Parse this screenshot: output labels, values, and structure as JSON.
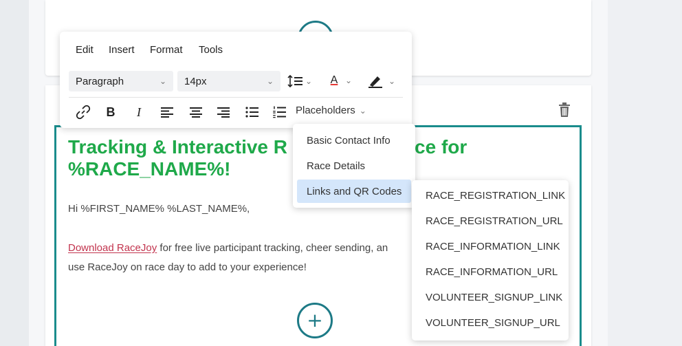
{
  "menubar": {
    "items": [
      {
        "label": "Edit"
      },
      {
        "label": "Insert"
      },
      {
        "label": "Format"
      },
      {
        "label": "Tools"
      }
    ]
  },
  "toolbar": {
    "block_format": "Paragraph",
    "font_size": "14px",
    "text_color": "#e53935",
    "placeholders_label": "Placeholders",
    "icons": [
      "line-height-icon",
      "text-color-icon",
      "highlight-icon",
      "link-icon",
      "bold-icon",
      "italic-icon",
      "align-left-icon",
      "align-center-icon",
      "align-right-icon",
      "bullet-list-icon",
      "numbered-list-icon"
    ],
    "bold_glyph": "B",
    "italic_glyph": "I",
    "text_color_glyph": "A"
  },
  "placeholders_menu": {
    "items": [
      {
        "label": "Basic Contact Info"
      },
      {
        "label": "Race Details"
      },
      {
        "label": "Links and QR Codes",
        "active": true
      }
    ]
  },
  "links_submenu": {
    "items": [
      {
        "label": "RACE_REGISTRATION_LINK"
      },
      {
        "label": "RACE_REGISTRATION_URL"
      },
      {
        "label": "RACE_INFORMATION_LINK"
      },
      {
        "label": "RACE_INFORMATION_URL"
      },
      {
        "label": "VOLUNTEER_SIGNUP_LINK"
      },
      {
        "label": "VOLUNTEER_SIGNUP_URL"
      }
    ]
  },
  "email": {
    "headline_line1_start": "Tracking & Interactive R",
    "headline_line1_end": "ce for",
    "headline_line2": "%RACE_NAME%!",
    "greeting": "Hi %FIRST_NAME% %LAST_NAME%,",
    "link_text": "Download RaceJoy",
    "body_line1_rest": " for free live participant tracking, cheer sending, an",
    "body_line2": "use RaceJoy on race day to add to your experience!"
  },
  "add_block": {
    "glyph": "+"
  },
  "colors": {
    "accent": "#1d7a86",
    "headline": "#1fa94a",
    "link": "#c2334d",
    "active_item": "#d4e6fb"
  }
}
